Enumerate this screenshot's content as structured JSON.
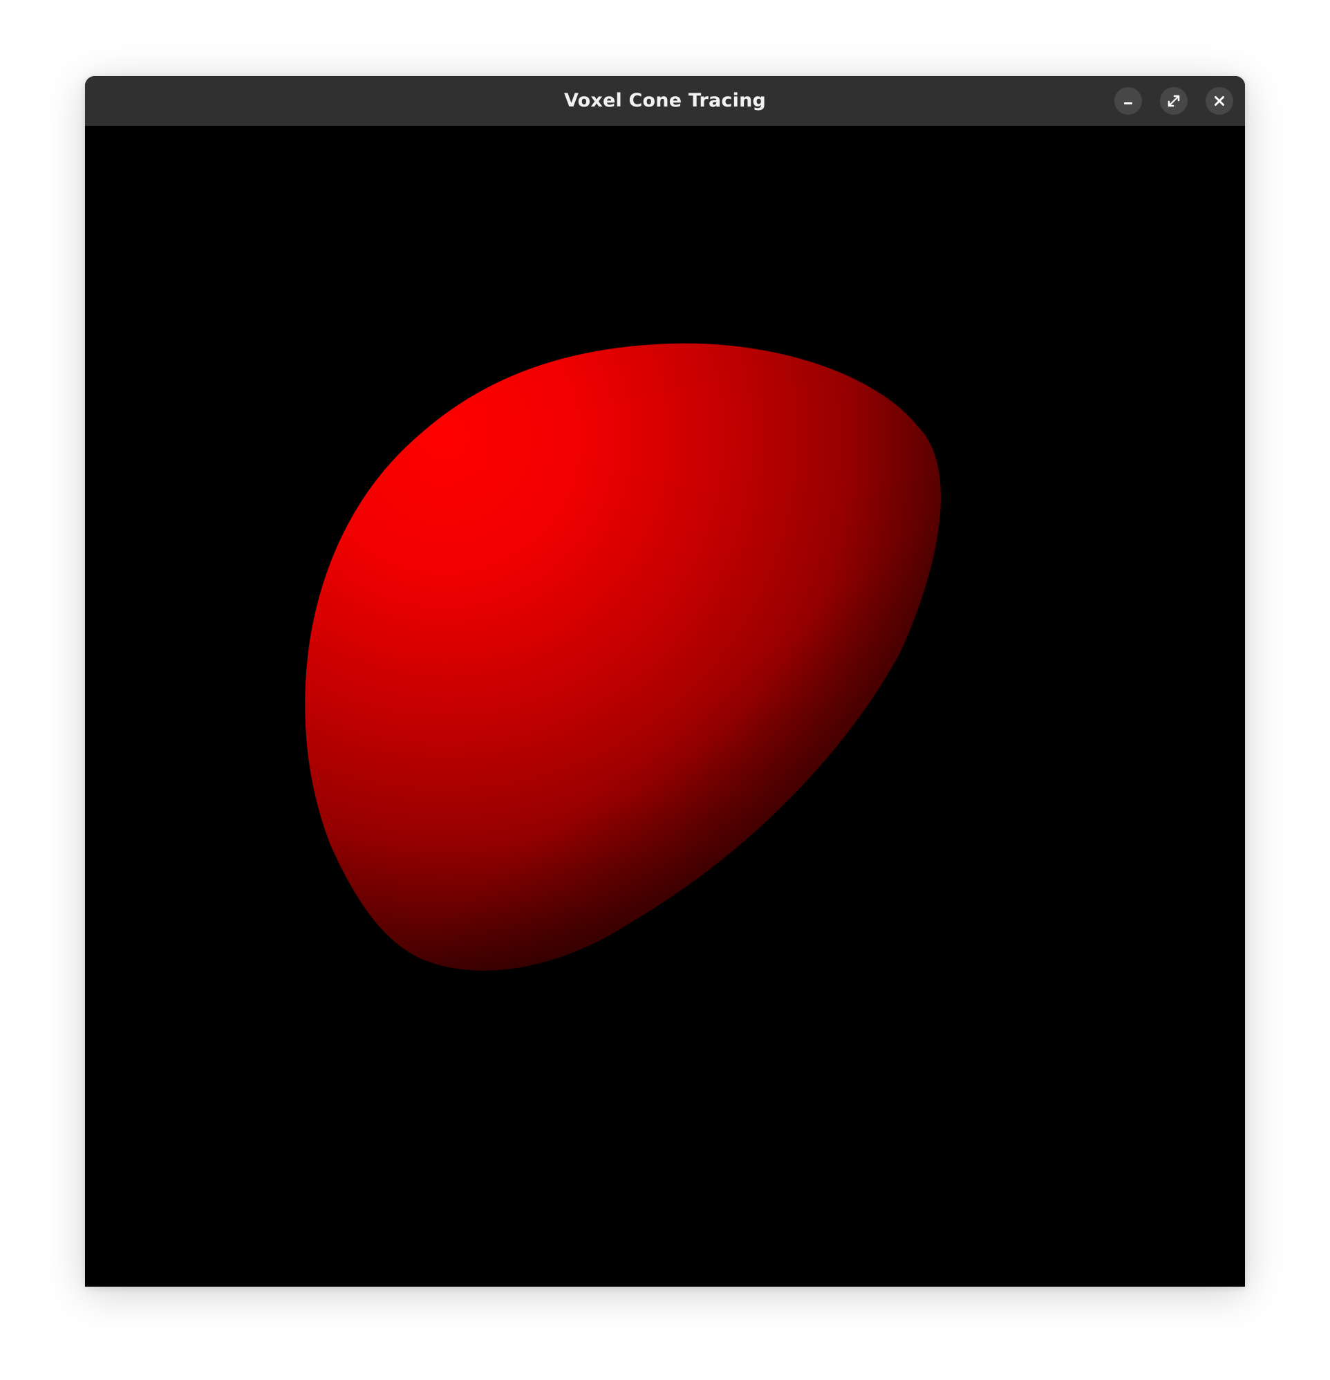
{
  "window": {
    "title": "Voxel Cone Tracing",
    "buttons": {
      "minimize_icon": "minimize-icon",
      "maximize_icon": "maximize-icon",
      "close_icon": "close-icon"
    }
  },
  "scene": {
    "background_color": "#000000",
    "object": "sphere",
    "object_color": "#ff0000",
    "shadow_color": "#000000"
  }
}
